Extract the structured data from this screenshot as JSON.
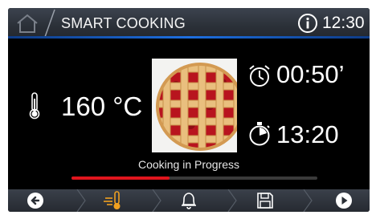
{
  "header": {
    "title": "SMART COOKING",
    "clock": "12:30",
    "icons": {
      "home": "home-icon",
      "info": "info-icon"
    }
  },
  "main": {
    "temperature": "160 °C",
    "timer": "00:50’",
    "end_time": "13:20",
    "image": "cherry-lattice-pie",
    "icons": {
      "temperature": "thermometer-icon",
      "timer": "timer-icon",
      "end_time": "stopwatch-icon"
    }
  },
  "status": {
    "text": "Cooking in Progress",
    "progress": 0.4
  },
  "nav": {
    "items": [
      {
        "icon": "back-icon"
      },
      {
        "icon": "heat-thermometer-icon"
      },
      {
        "icon": "bell-icon"
      },
      {
        "icon": "save-icon"
      },
      {
        "icon": "play-icon"
      }
    ]
  },
  "colors": {
    "accent_blue": "#1e6fe0",
    "progress_red": "#e0151d",
    "heat_orange": "#f0a020",
    "background": "#000000"
  }
}
